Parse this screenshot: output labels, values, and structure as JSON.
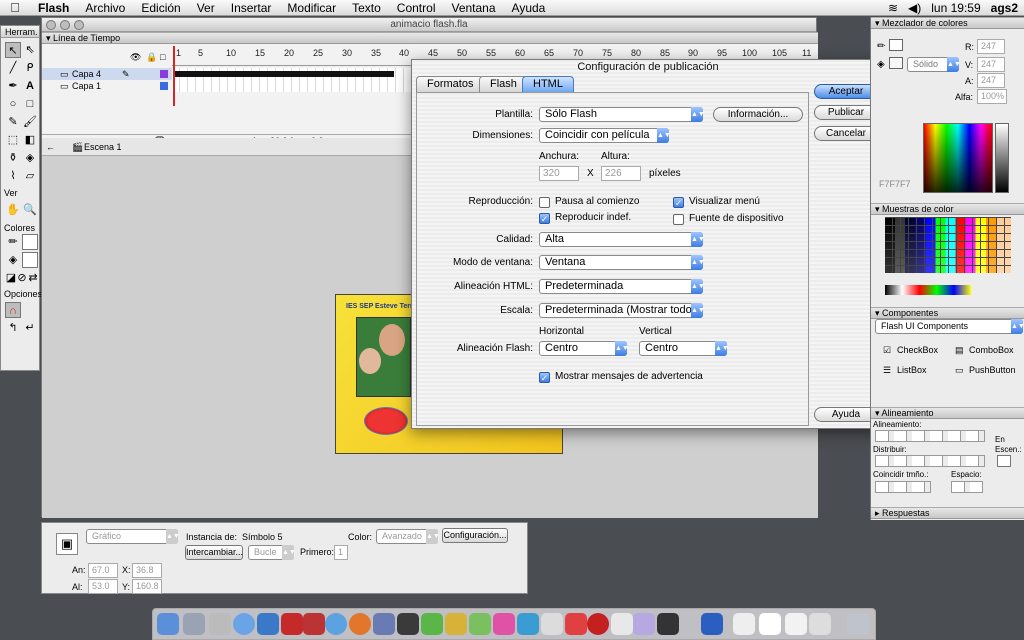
{
  "menubar": {
    "app": "Flash",
    "items": [
      "Archivo",
      "Edición",
      "Ver",
      "Insertar",
      "Modificar",
      "Texto",
      "Control",
      "Ventana",
      "Ayuda"
    ],
    "clock": "lun 19:59",
    "user": "ags2"
  },
  "tools": {
    "title": "Herram.",
    "view_label": "Ver",
    "colors_label": "Colores",
    "options_label": "Opciones"
  },
  "document": {
    "title": "animacio flash.fla",
    "timeline_title": "Línea de Tiempo",
    "layers": [
      "Capa 4",
      "Capa 1"
    ],
    "ruler": [
      "1",
      "5",
      "10",
      "15",
      "20",
      "25",
      "30",
      "35",
      "40",
      "45",
      "50",
      "55",
      "60",
      "65",
      "70",
      "75",
      "80",
      "85",
      "90",
      "95",
      "100",
      "105",
      "11"
    ],
    "frame_num": "1",
    "fps": "20.0 fps",
    "time": "0.0s",
    "scene": "Escena 1",
    "picture_header": "IES SEP Esteve Terra"
  },
  "dialog": {
    "title": "Configuración de publicación",
    "tabs": [
      "Formatos",
      "Flash",
      "HTML"
    ],
    "plantilla_label": "Plantilla:",
    "plantilla_value": "Sólo Flash",
    "info_button": "Información...",
    "dimensiones_label": "Dimensiones:",
    "dimensiones_value": "Coincidir con película",
    "anchura_label": "Anchura:",
    "altura_label": "Altura:",
    "anchura_value": "320",
    "altura_value": "226",
    "x_label": "X",
    "pixeles_label": "píxeles",
    "reproduccion_label": "Reproducción:",
    "pausa": "Pausa al comienzo",
    "reproducir": "Reproducir indef.",
    "visualizar": "Visualizar menú",
    "fuente": "Fuente de dispositivo",
    "calidad_label": "Calidad:",
    "calidad_value": "Alta",
    "modo_label": "Modo de ventana:",
    "modo_value": "Ventana",
    "alin_html_label": "Alineación HTML:",
    "alin_html_value": "Predeterminada",
    "escala_label": "Escala:",
    "escala_value": "Predeterminada (Mostrar todo)",
    "horizontal_label": "Horizontal",
    "vertical_label": "Vertical",
    "alin_flash_label": "Alineación Flash:",
    "h_value": "Centro",
    "v_value": "Centro",
    "mostrar": "Mostrar mensajes de advertencia",
    "aceptar": "Aceptar",
    "publicar": "Publicar",
    "cancelar": "Cancelar",
    "ayuda": "Ayuda"
  },
  "mixer": {
    "title": "Mezclador de colores",
    "fill_type": "Sólido",
    "r_label": "R:",
    "r_value": "247",
    "v_label": "V:",
    "v_value": "247",
    "a_label": "A:",
    "a_value": "247",
    "alfa_label": "Alfa:",
    "alfa_value": "100%",
    "hex": "F7F7F7"
  },
  "swatches_title": "Muestras de color",
  "components": {
    "title": "Componentes",
    "set": "Flash UI Components",
    "items": [
      "CheckBox",
      "ComboBox",
      "ListBox",
      "PushButton"
    ]
  },
  "align": {
    "title": "Alineamiento",
    "alinear": "Alineamiento:",
    "distribuir": "Distribuir:",
    "coincidir": "Coincidir tmño.:",
    "espacio": "Espacio:",
    "en": "En",
    "escena": "Escen.:"
  },
  "respuestas": "Respuestas",
  "props": {
    "type": "Gráfico",
    "instancia_label": "Instancia de:",
    "instancia_value": "Símbolo 5",
    "color_label": "Color:",
    "color_value": "Avanzado",
    "config_button": "Configuración...",
    "intercambiar": "Intercambiar...",
    "bucle": "Bucle",
    "primero_label": "Primero:",
    "primero_value": "1",
    "an_label": "An:",
    "an_value": "67.0",
    "x_label": "X:",
    "x_value": "36.8",
    "al_label": "Al:",
    "al_value": "53.0",
    "y_label": "Y:",
    "y_value": "160.8"
  }
}
